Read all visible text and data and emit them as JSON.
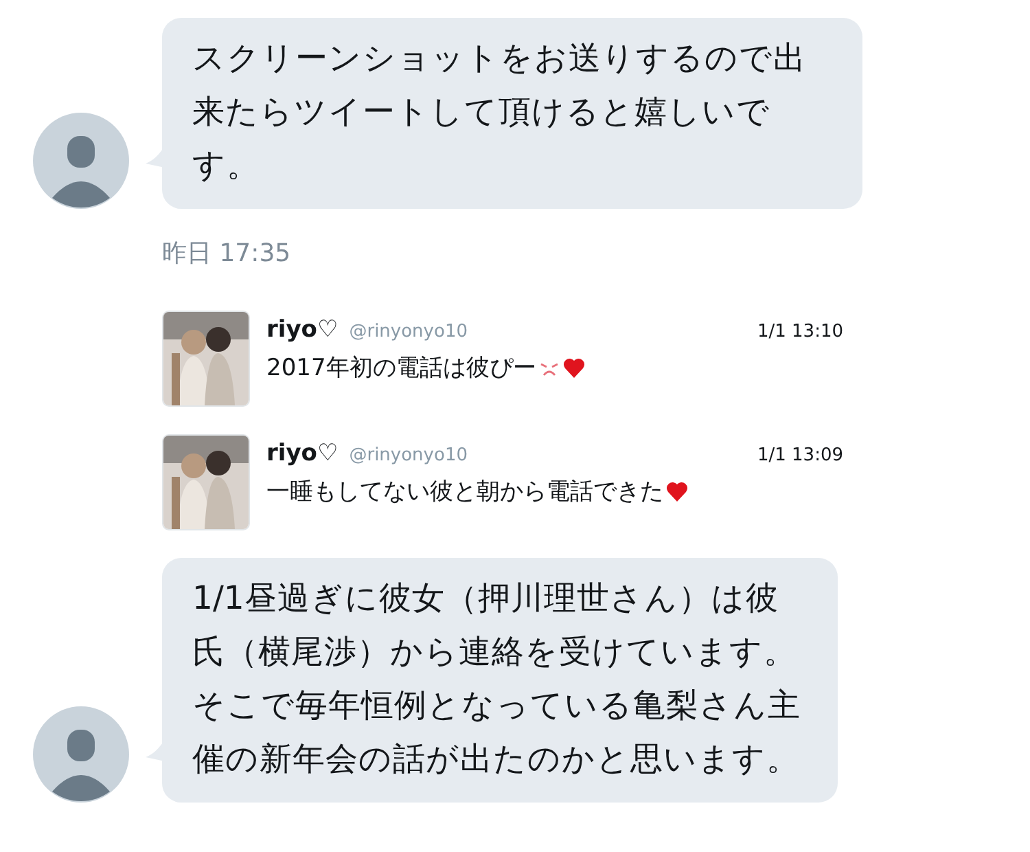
{
  "messages": [
    {
      "kind": "text",
      "text": "スクリーンショットをお送りするので出来たらツイートして頂けると嬉しいです。"
    },
    {
      "kind": "time",
      "text": "昨日 17:35"
    },
    {
      "kind": "tweet",
      "name": "riyo♡",
      "handle": "@rinyonyo10",
      "time": "1/1 13:10",
      "text": "2017年初の電話は彼ぴー",
      "emoji": [
        {
          "kind": "frown"
        },
        {
          "kind": "heart"
        }
      ]
    },
    {
      "kind": "tweet",
      "name": "riyo♡",
      "handle": "@rinyonyo10",
      "time": "1/1 13:09",
      "text": "一睡もしてない彼と朝から電話できた",
      "emoji": [
        {
          "kind": "heart"
        }
      ]
    },
    {
      "kind": "text",
      "text": "1/1昼過ぎに彼女（押川理世さん）は彼氏（横尾渉）から連絡を受けています。そこで毎年恒例となっている亀梨さん主催の新年会の話が出たのかと思います。"
    }
  ]
}
